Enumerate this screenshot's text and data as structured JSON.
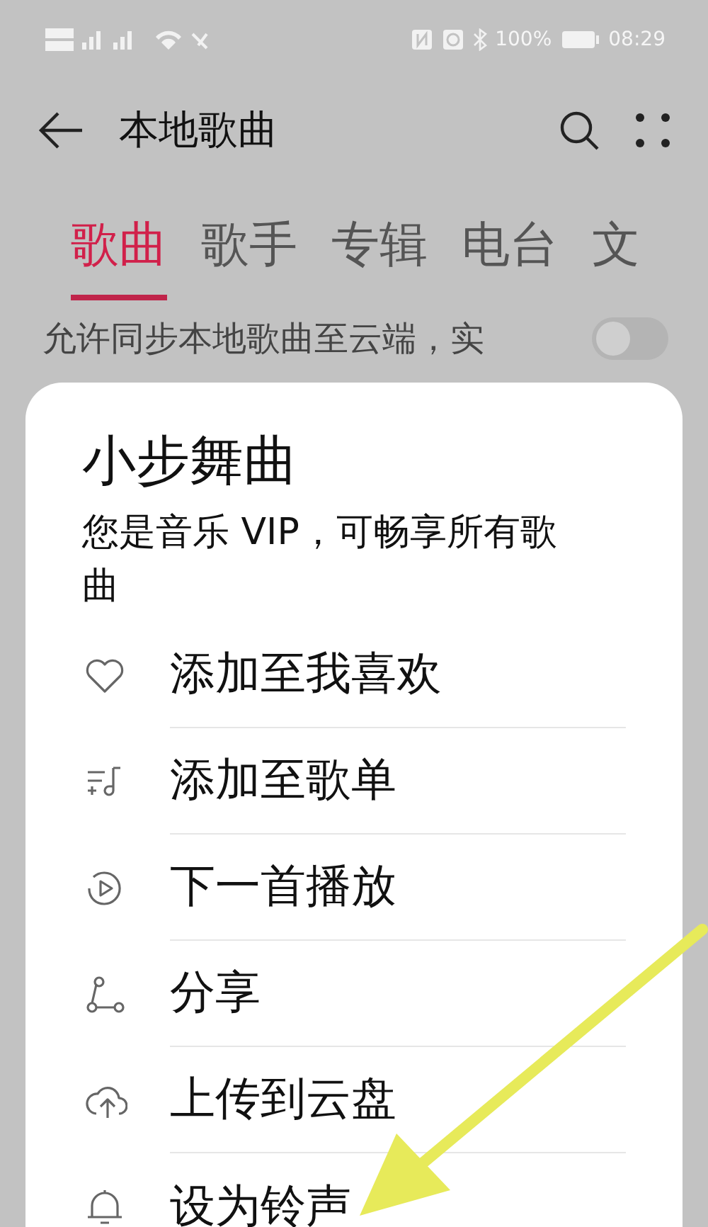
{
  "status_bar": {
    "battery": "100%",
    "time": "08:29"
  },
  "header": {
    "title": "本地歌曲"
  },
  "tabs": [
    {
      "label": "歌曲",
      "selected": true
    },
    {
      "label": "歌手",
      "selected": false
    },
    {
      "label": "专辑",
      "selected": false
    },
    {
      "label": "电台",
      "selected": false
    },
    {
      "label": "文",
      "selected": false
    }
  ],
  "sync_row": {
    "label": "允许同步本地歌曲至云端，实",
    "on": false
  },
  "sheet": {
    "title": "小步舞曲",
    "subtitle": "您是音乐 VIP，可畅享所有歌曲",
    "items": [
      {
        "kind": "heart",
        "label": "添加至我喜欢"
      },
      {
        "kind": "playlist",
        "label": "添加至歌单"
      },
      {
        "kind": "next",
        "label": "下一首播放"
      },
      {
        "kind": "share",
        "label": "分享"
      },
      {
        "kind": "upload",
        "label": "上传到云盘"
      },
      {
        "kind": "bell",
        "label": "设为铃声"
      }
    ]
  }
}
